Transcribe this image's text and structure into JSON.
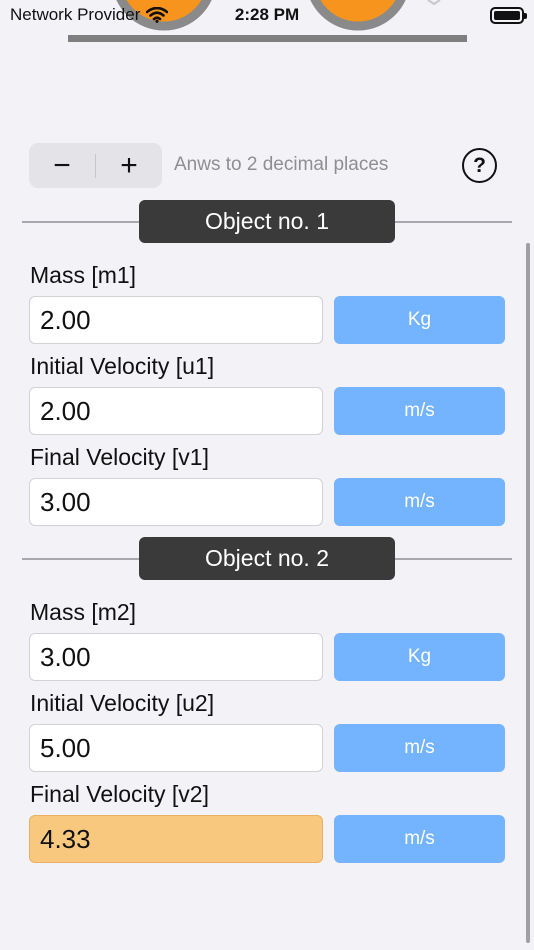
{
  "status": {
    "carrier": "Network Provider",
    "time": "2:28 PM"
  },
  "toolbar": {
    "minus": "−",
    "plus": "+",
    "hint": "Anws to 2 decimal places",
    "help": "?"
  },
  "colors": {
    "accent_orange": "#f7941d",
    "unit_blue": "#74b3fd",
    "result_fill": "#f8c87f",
    "header_bg": "#3a3a3a"
  },
  "object1": {
    "title": "Object no. 1",
    "mass_label": "Mass [m1]",
    "mass_value": "2.00",
    "mass_unit": "Kg",
    "u_label": "Initial Velocity [u1]",
    "u_value": "2.00",
    "u_unit": "m/s",
    "v_label": "Final Velocity [v1]",
    "v_value": "3.00",
    "v_unit": "m/s"
  },
  "object2": {
    "title": "Object no. 2",
    "mass_label": "Mass [m2]",
    "mass_value": "3.00",
    "mass_unit": "Kg",
    "u_label": "Initial Velocity [u2]",
    "u_value": "5.00",
    "u_unit": "m/s",
    "v_label": "Final Velocity [v2]",
    "v_value": "4.33",
    "v_unit": "m/s"
  },
  "icons": [
    "wifi-icon",
    "battery-icon",
    "help-icon",
    "minus-icon",
    "plus-icon"
  ]
}
